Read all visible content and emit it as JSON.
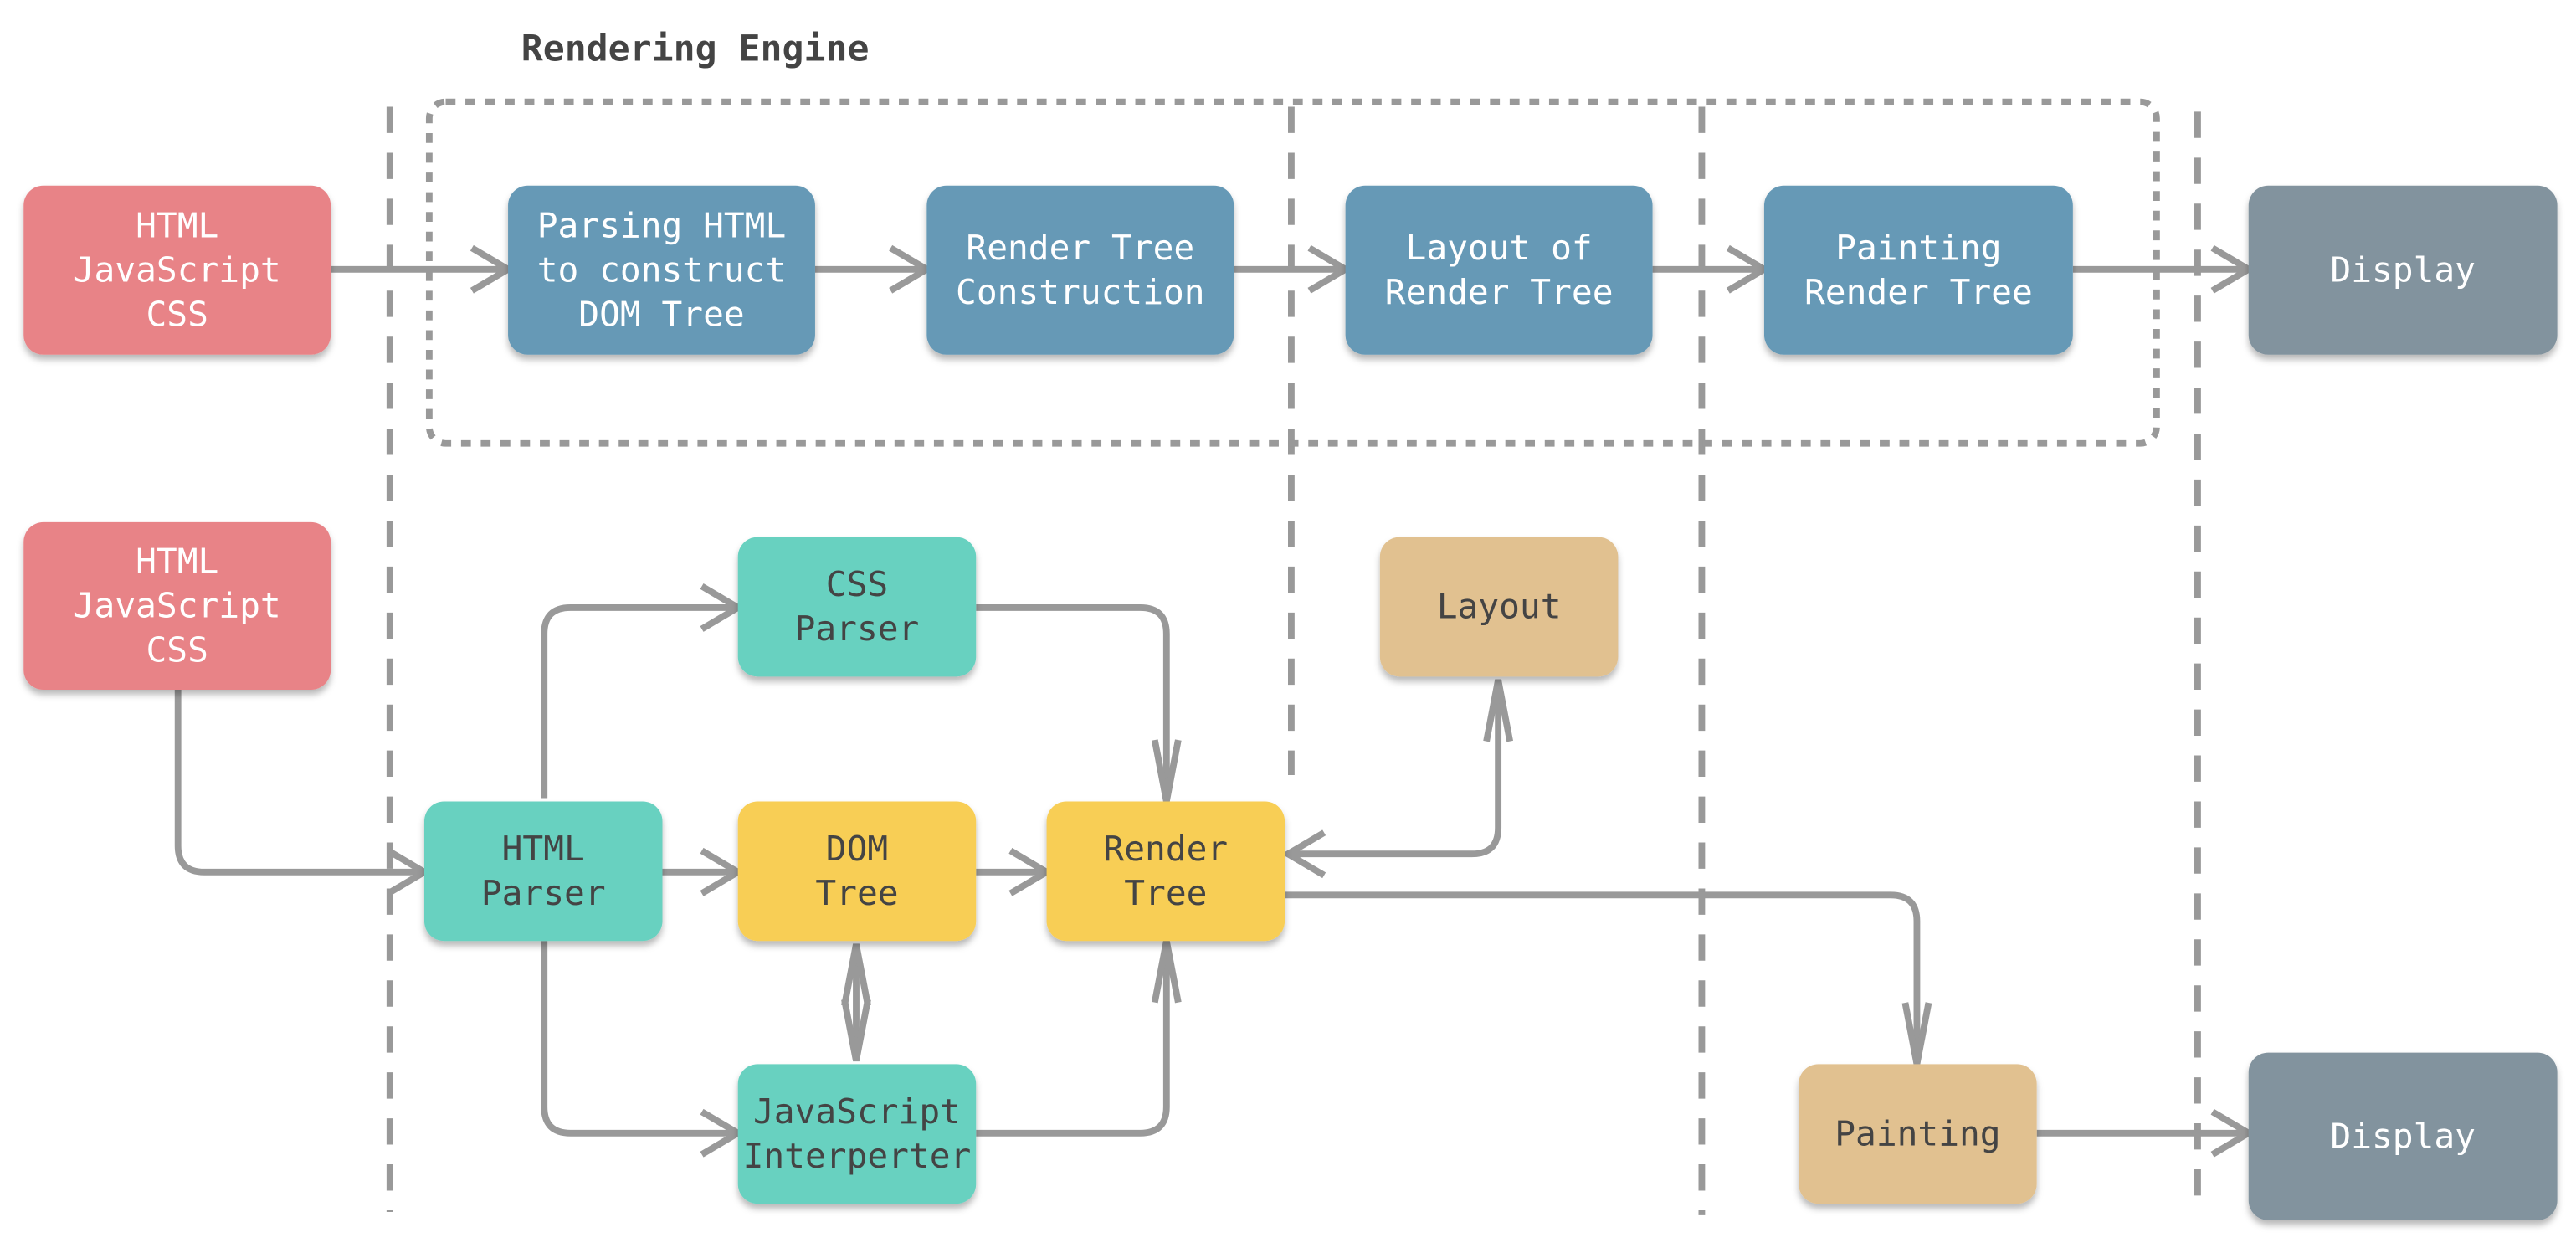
{
  "title": "Rendering Engine",
  "colors": {
    "input": "#E88387",
    "stage": "#6699B6",
    "display": "#82939E",
    "parser": "#68D1C0",
    "tree": "#F8CE55",
    "process": "#E1C190",
    "edge": "#999999",
    "light_text": "#FFFFFF",
    "dark_text": "#444444"
  },
  "top_row": {
    "nodes": [
      {
        "id": "input-top",
        "lines": [
          "HTML",
          "JavaScript",
          "CSS"
        ],
        "kind": "input"
      },
      {
        "id": "parsing-html",
        "lines": [
          "Parsing HTML",
          "to construct",
          "DOM Tree"
        ],
        "kind": "stage"
      },
      {
        "id": "render-tree-construction",
        "lines": [
          "Render Tree",
          "Construction"
        ],
        "kind": "stage"
      },
      {
        "id": "layout-of-render-tree",
        "lines": [
          "Layout of",
          "Render Tree"
        ],
        "kind": "stage"
      },
      {
        "id": "painting-render-tree",
        "lines": [
          "Painting",
          "Render Tree"
        ],
        "kind": "stage"
      },
      {
        "id": "display-top",
        "lines": [
          "Display"
        ],
        "kind": "display"
      }
    ]
  },
  "bottom_row": {
    "nodes": [
      {
        "id": "input-bottom",
        "lines": [
          "HTML",
          "JavaScript",
          "CSS"
        ],
        "kind": "input"
      },
      {
        "id": "css-parser",
        "lines": [
          "CSS",
          "Parser"
        ],
        "kind": "parser"
      },
      {
        "id": "layout",
        "lines": [
          "Layout"
        ],
        "kind": "process"
      },
      {
        "id": "html-parser",
        "lines": [
          "HTML",
          "Parser"
        ],
        "kind": "parser"
      },
      {
        "id": "dom-tree",
        "lines": [
          "DOM",
          "Tree"
        ],
        "kind": "tree"
      },
      {
        "id": "render-tree",
        "lines": [
          "Render",
          "Tree"
        ],
        "kind": "tree"
      },
      {
        "id": "javascript-interpreter",
        "lines": [
          "JavaScript",
          "Interperter"
        ],
        "kind": "parser"
      },
      {
        "id": "painting",
        "lines": [
          "Painting"
        ],
        "kind": "process"
      },
      {
        "id": "display-bottom",
        "lines": [
          "Display"
        ],
        "kind": "display"
      }
    ]
  },
  "edges": [
    {
      "from": "input-top",
      "to": "parsing-html"
    },
    {
      "from": "parsing-html",
      "to": "render-tree-construction"
    },
    {
      "from": "render-tree-construction",
      "to": "layout-of-render-tree"
    },
    {
      "from": "layout-of-render-tree",
      "to": "painting-render-tree"
    },
    {
      "from": "painting-render-tree",
      "to": "display-top"
    },
    {
      "from": "input-bottom",
      "to": "html-parser"
    },
    {
      "from": "html-parser",
      "to": "css-parser"
    },
    {
      "from": "html-parser",
      "to": "dom-tree"
    },
    {
      "from": "html-parser",
      "to": "javascript-interpreter"
    },
    {
      "from": "css-parser",
      "to": "render-tree"
    },
    {
      "from": "dom-tree",
      "to": "render-tree"
    },
    {
      "from": "dom-tree",
      "to": "javascript-interpreter",
      "bidirectional": true
    },
    {
      "from": "javascript-interpreter",
      "to": "render-tree"
    },
    {
      "from": "render-tree",
      "to": "layout",
      "bidirectional": true
    },
    {
      "from": "render-tree",
      "to": "painting"
    },
    {
      "from": "painting",
      "to": "display-bottom"
    }
  ]
}
